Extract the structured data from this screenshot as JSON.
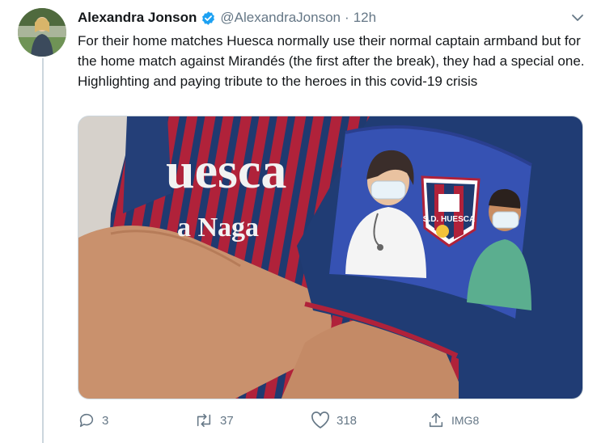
{
  "tweet": {
    "author_name": "Alexandra Jonson",
    "handle": "@AlexandraJonson",
    "separator": "·",
    "time": "12h",
    "text": "For their home matches Huesca normally use their normal captain armband but for the home match against Mirandés (the first after the break), they had a special one. Highlighting and paying tribute to the heroes in this covid-19 crisis",
    "verified": true
  },
  "media": {
    "shirt_text_1": "uesca",
    "shirt_text_2": "a Naga",
    "badge_text": "S.D. HUESCA",
    "colors": {
      "shirt_blue": "#1f3a70",
      "shirt_red": "#b0223a",
      "armband_blue": "#3652b3",
      "background": "#d6d1cb"
    }
  },
  "actions": {
    "reply_count": "3",
    "retweet_count": "37",
    "like_count": "318",
    "share_label": "IMG8"
  },
  "icons": [
    "verified-badge-icon",
    "chevron-down-icon",
    "reply-icon",
    "retweet-icon",
    "like-icon",
    "share-icon"
  ]
}
